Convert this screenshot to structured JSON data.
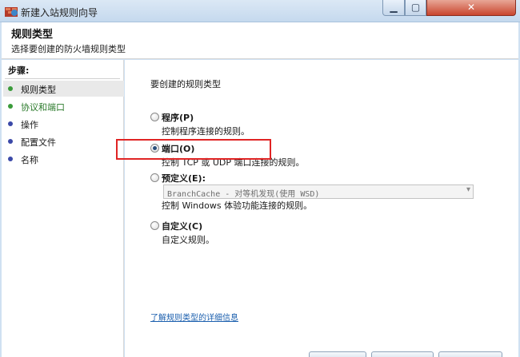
{
  "window": {
    "title": "新建入站规则向导"
  },
  "header": {
    "title": "规则类型",
    "subtitle": "选择要创建的防火墙规则类型"
  },
  "sidebar": {
    "steps_label": "步骤:",
    "items": [
      {
        "label": "规则类型",
        "state": "current",
        "dot_color": "#3a9b3a"
      },
      {
        "label": "协议和端口",
        "state": "done",
        "dot_color": "#3a9b3a"
      },
      {
        "label": "操作",
        "state": "todo",
        "dot_color": "#3b49a8"
      },
      {
        "label": "配置文件",
        "state": "todo",
        "dot_color": "#3b49a8"
      },
      {
        "label": "名称",
        "state": "todo",
        "dot_color": "#3b49a8"
      }
    ]
  },
  "main": {
    "prompt": "要创建的规则类型",
    "options": [
      {
        "label": "程序(P)",
        "desc": "控制程序连接的规则。",
        "selected": false
      },
      {
        "label": "端口(O)",
        "desc": "控制 TCP 或 UDP 端口连接的规则。",
        "selected": true
      },
      {
        "label": "预定义(E):",
        "desc": "控制 Windows 体验功能连接的规则。",
        "selected": false
      },
      {
        "label": "自定义(C)",
        "desc": "自定义规则。",
        "selected": false
      }
    ],
    "predefined_select": {
      "value": "BranchCache - 对等机发现(使用 WSD)"
    },
    "learn_link": "了解规则类型的详细信息"
  },
  "colors": {
    "highlight": "#e02424",
    "link": "#1b5fae"
  }
}
